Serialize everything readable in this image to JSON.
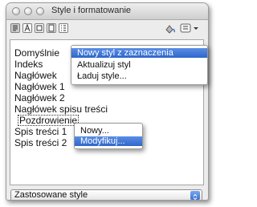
{
  "window": {
    "title": "Style i formatowanie"
  },
  "style_list": [
    "Domyślnie",
    "Indeks",
    "Nagłówek",
    "Nagłówek 1",
    "Nagłówek 2",
    "Nagłówek spisu treści",
    "Pozdrowienie",
    "Spis treści 1",
    "Spis treści 2"
  ],
  "new_style_menu": {
    "items": [
      "Nowy styl z zaznaczenia",
      "Aktualizuj styl",
      "Ładuj style..."
    ],
    "highlighted": "Nowy styl z zaznaczenia"
  },
  "context_menu": {
    "items": [
      "Nowy...",
      "Modyfikuj..."
    ],
    "highlighted": "Modyfikuj..."
  },
  "filter": {
    "selected": "Zastosowane style"
  },
  "colors": {
    "highlight": "#3d73d3",
    "window_bg": "#ececec"
  },
  "icons": [
    "paragraph-style-icon",
    "character-style-icon",
    "frame-style-icon",
    "page-style-icon",
    "list-style-icon",
    "fill-format-icon",
    "new-style-icon"
  ]
}
